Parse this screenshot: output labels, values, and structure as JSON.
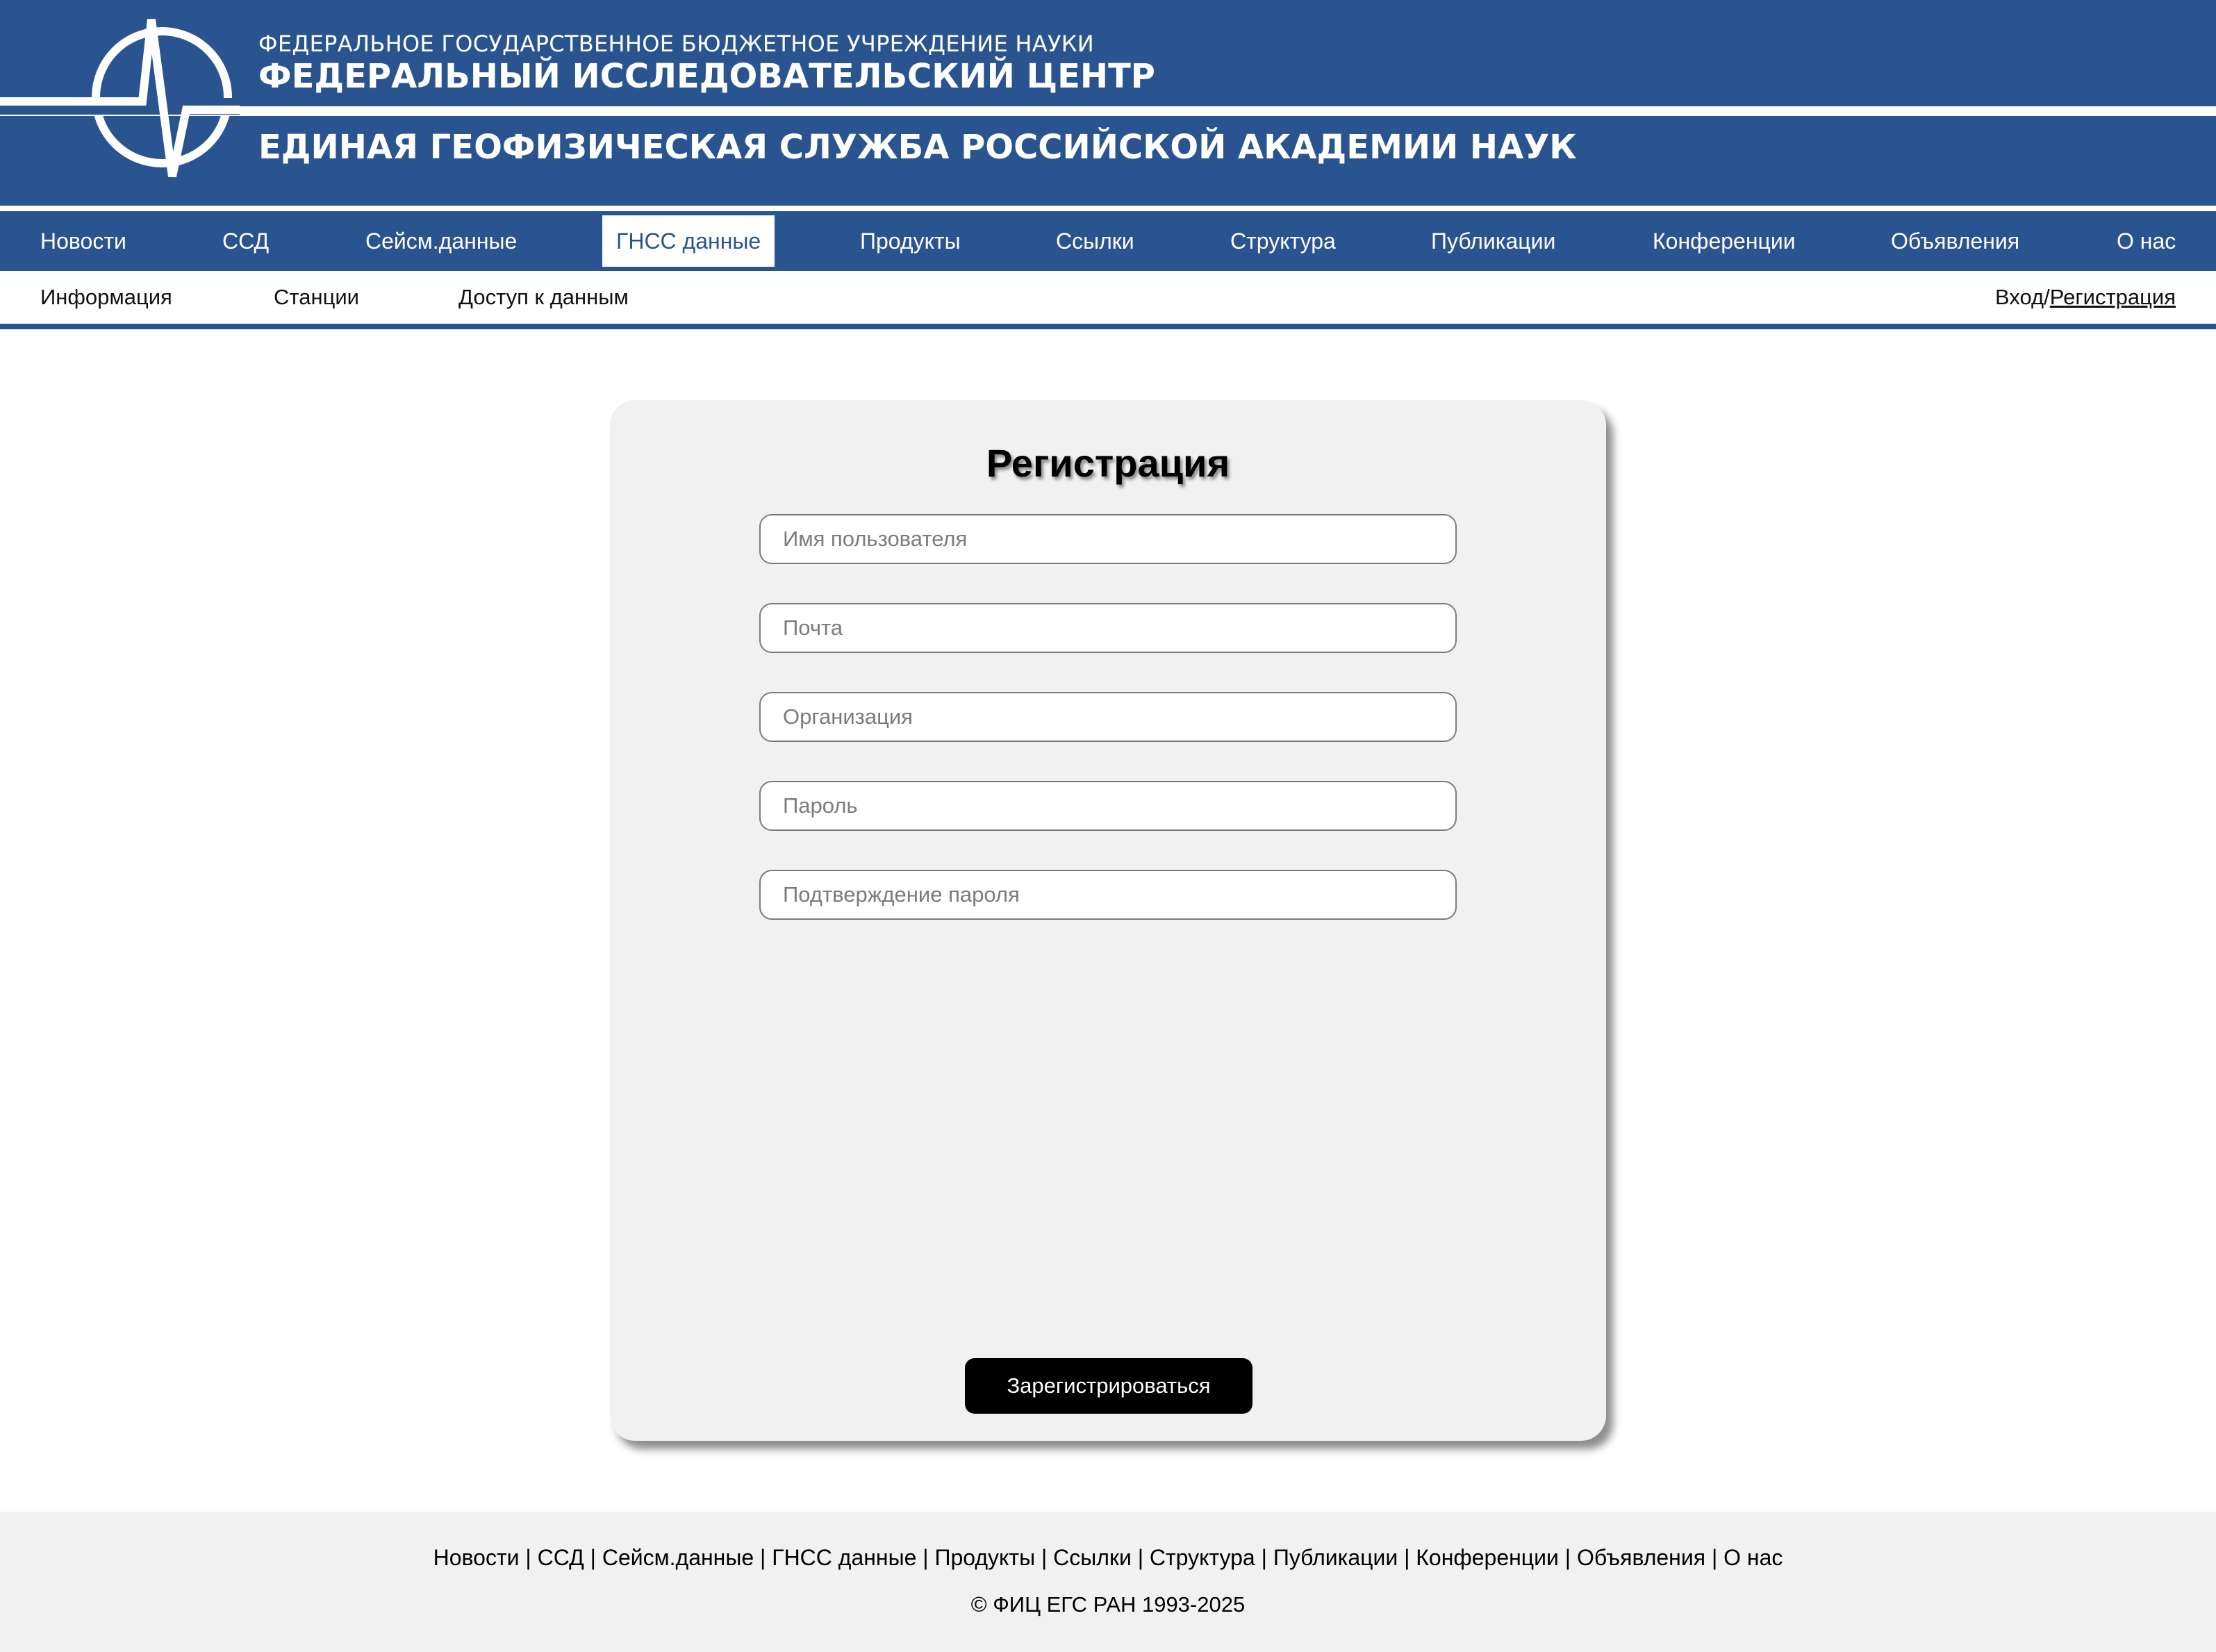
{
  "header": {
    "org_top": "ФЕДЕРАЛЬНОЕ ГОСУДАРСТВЕННОЕ БЮДЖЕТНОЕ УЧРЕЖДЕНИЕ НАУКИ",
    "org_main": "ФЕДЕРАЛЬНЫЙ ИССЛЕДОВАТЕЛЬСКИЙ ЦЕНТР",
    "org_service": "ЕДИНАЯ ГЕОФИЗИЧЕСКАЯ СЛУЖБА РОССИЙСКОЙ АКАДЕМИИ НАУК",
    "logo_icon": "seismogram-circle-logo"
  },
  "nav": {
    "items": [
      {
        "label": "Новости"
      },
      {
        "label": "ССД"
      },
      {
        "label": "Сейсм.данные"
      },
      {
        "label": "ГНСС данные",
        "active": true
      },
      {
        "label": "Продукты"
      },
      {
        "label": "Ссылки"
      },
      {
        "label": "Структура"
      },
      {
        "label": "Публикации"
      },
      {
        "label": "Конференции"
      },
      {
        "label": "Объявления"
      },
      {
        "label": "О нас"
      }
    ]
  },
  "subnav": {
    "items": [
      {
        "label": "Информация"
      },
      {
        "label": "Станции"
      },
      {
        "label": "Доступ к данным"
      }
    ],
    "login": "Вход",
    "separator": "/",
    "register": "Регистрация"
  },
  "form": {
    "title": "Регистрация",
    "fields": {
      "username": {
        "placeholder": "Имя пользователя",
        "value": ""
      },
      "email": {
        "placeholder": "Почта",
        "value": ""
      },
      "organization": {
        "placeholder": "Организация",
        "value": ""
      },
      "password": {
        "placeholder": "Пароль",
        "value": ""
      },
      "password_confirm": {
        "placeholder": "Подтверждение пароля",
        "value": ""
      }
    },
    "submit_label": "Зарегистрироваться"
  },
  "footer": {
    "links": "Новости | ССД | Сейсм.данные | ГНСС данные | Продукты | Ссылки | Структура | Публикации | Конференции | Объявления | О нас",
    "copyright": "© ФИЦ ЕГС РАН 1993-2025"
  },
  "colors": {
    "brand_blue": "#2a548f",
    "card_bg": "#f1f1f1",
    "footer_bg": "#f1f1f1",
    "button_bg": "#000000"
  }
}
